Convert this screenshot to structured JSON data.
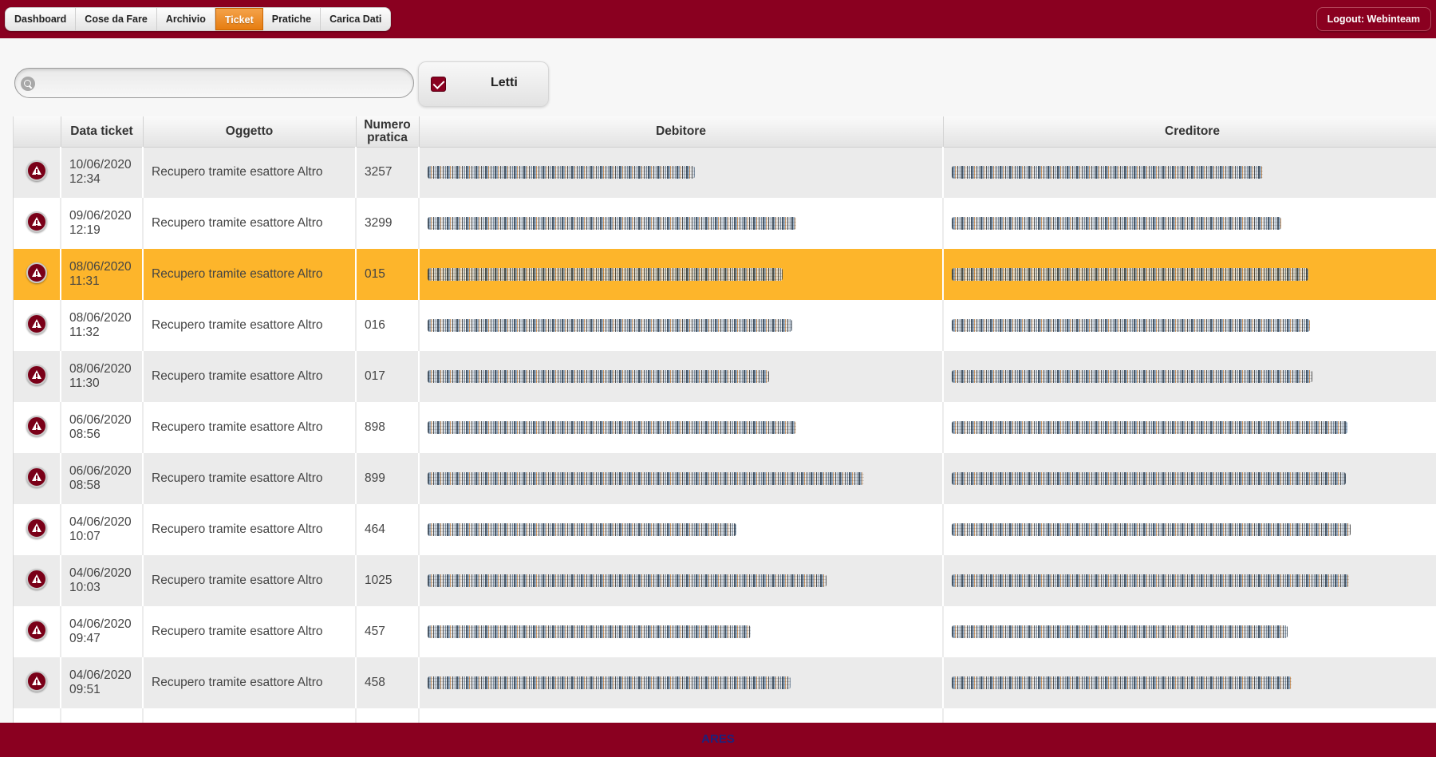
{
  "nav": {
    "items": [
      {
        "label": "Dashboard",
        "active": false
      },
      {
        "label": "Cose da Fare",
        "active": false
      },
      {
        "label": "Archivio",
        "active": false
      },
      {
        "label": "Ticket",
        "active": true
      },
      {
        "label": "Pratiche",
        "active": false
      },
      {
        "label": "Carica Dati",
        "active": false
      }
    ],
    "logout_label": "Logout: Webinteam"
  },
  "filters": {
    "search_value": "",
    "search_placeholder": "",
    "letti_label": "Letti",
    "letti_checked": true
  },
  "table": {
    "columns": [
      "",
      "Data ticket",
      "Oggetto",
      "Numero pratica",
      "Debitore",
      "Creditore"
    ],
    "rows": [
      {
        "date": "10/06/2020",
        "time": "12:34",
        "oggetto": "Recupero tramite esattore Altro",
        "numero": "3257",
        "selected": false
      },
      {
        "date": "09/06/2020",
        "time": "12:19",
        "oggetto": "Recupero tramite esattore Altro",
        "numero": "3299",
        "selected": false
      },
      {
        "date": "08/06/2020",
        "time": "11:31",
        "oggetto": "Recupero tramite esattore Altro",
        "numero": "015",
        "selected": true
      },
      {
        "date": "08/06/2020",
        "time": "11:32",
        "oggetto": "Recupero tramite esattore Altro",
        "numero": "016",
        "selected": false
      },
      {
        "date": "08/06/2020",
        "time": "11:30",
        "oggetto": "Recupero tramite esattore Altro",
        "numero": "017",
        "selected": false
      },
      {
        "date": "06/06/2020",
        "time": "08:56",
        "oggetto": "Recupero tramite esattore Altro",
        "numero": "898",
        "selected": false
      },
      {
        "date": "06/06/2020",
        "time": "08:58",
        "oggetto": "Recupero tramite esattore Altro",
        "numero": "899",
        "selected": false
      },
      {
        "date": "04/06/2020",
        "time": "10:07",
        "oggetto": "Recupero tramite esattore Altro",
        "numero": "464",
        "selected": false
      },
      {
        "date": "04/06/2020",
        "time": "10:03",
        "oggetto": "Recupero tramite esattore Altro",
        "numero": "1025",
        "selected": false
      },
      {
        "date": "04/06/2020",
        "time": "09:47",
        "oggetto": "Recupero tramite esattore Altro",
        "numero": "457",
        "selected": false
      },
      {
        "date": "04/06/2020",
        "time": "09:51",
        "oggetto": "Recupero tramite esattore Altro",
        "numero": "458",
        "selected": false
      },
      {
        "date": "",
        "time": "",
        "oggetto": "",
        "numero": "",
        "selected": false
      }
    ]
  },
  "footer": {
    "label": "ARES"
  },
  "colors": {
    "brand": "#8a0020",
    "active_tab": "#e67d10",
    "selected_row": "#fdb52b",
    "footer_text": "#1a237e"
  },
  "icons": {
    "row_icon": "warning-icon",
    "search": "search-icon",
    "checkbox": "checkbox-checked-icon"
  }
}
